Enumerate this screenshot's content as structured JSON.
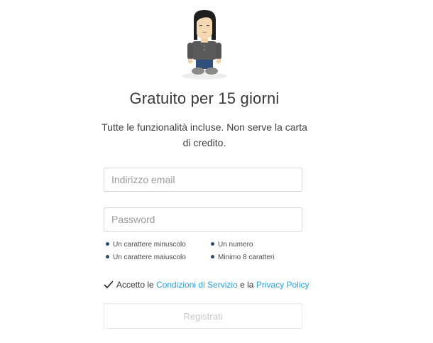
{
  "hero": {
    "avatar_icon": "person-avatar-icon",
    "title": "Gratuito per 15 giorni",
    "subtitle": "Tutte le funzionalità incluse. Non serve la carta di credito."
  },
  "form": {
    "email_placeholder": "Indirizzo email",
    "email_value": "",
    "password_placeholder": "Password",
    "password_value": ""
  },
  "password_rules": [
    {
      "label": "Un carattere minuscolo"
    },
    {
      "label": "Un numero"
    },
    {
      "label": "Un carattere maiuscolo"
    },
    {
      "label": "Minimo 8 caratteri"
    }
  ],
  "terms": {
    "prefix": "Accetto le",
    "terms_link": "Condizioni di Servizio",
    "middle": "e la",
    "privacy_link": "Privacy Policy",
    "checked": true,
    "check_icon": "checkmark-icon"
  },
  "submit": {
    "label": "Registrati",
    "enabled": false
  },
  "colors": {
    "link": "#2aa0d8",
    "bullet": "#2d4a73",
    "disabled_text": "#c8c8c8"
  }
}
